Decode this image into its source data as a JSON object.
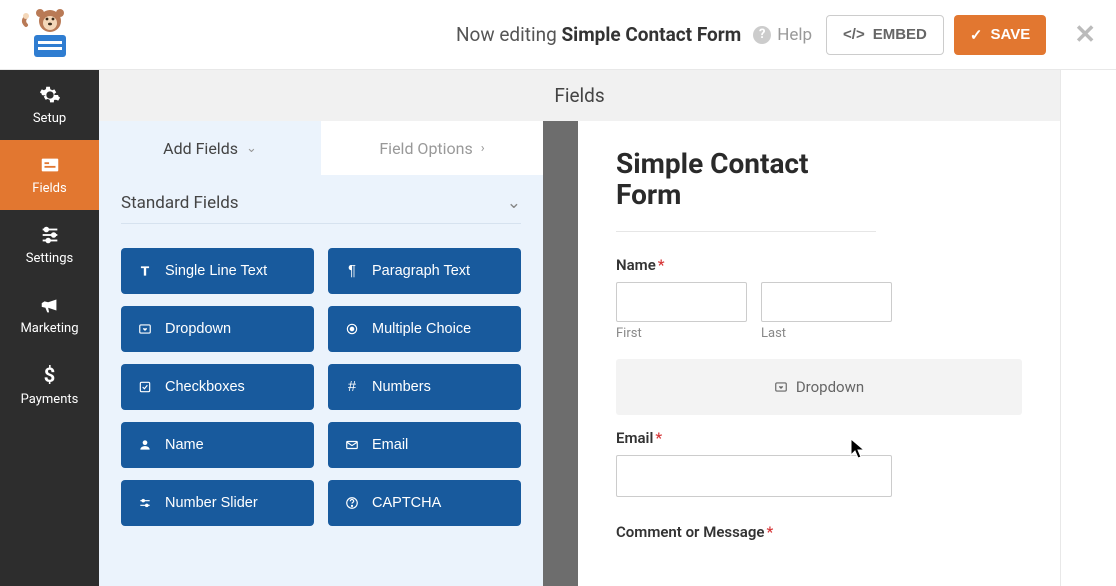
{
  "header": {
    "editing_prefix": "Now editing",
    "form_name": "Simple Contact Form",
    "help": "Help",
    "embed": "EMBED",
    "save": "SAVE"
  },
  "sidebar": {
    "items": [
      {
        "label": "Setup"
      },
      {
        "label": "Fields"
      },
      {
        "label": "Settings"
      },
      {
        "label": "Marketing"
      },
      {
        "label": "Payments"
      }
    ]
  },
  "page": {
    "title": "Fields"
  },
  "tabs": {
    "add": "Add Fields",
    "options": "Field Options"
  },
  "section": {
    "standard": "Standard Fields"
  },
  "fields": {
    "single_line_text": "Single Line Text",
    "paragraph_text": "Paragraph Text",
    "dropdown": "Dropdown",
    "multiple_choice": "Multiple Choice",
    "checkboxes": "Checkboxes",
    "numbers": "Numbers",
    "name": "Name",
    "email": "Email",
    "number_slider": "Number Slider",
    "captcha": "CAPTCHA"
  },
  "preview": {
    "form_title": "Simple Contact Form",
    "name_label": "Name",
    "first": "First",
    "last": "Last",
    "dropzone": "Dropdown",
    "email_label": "Email",
    "comment_label": "Comment or Message"
  }
}
